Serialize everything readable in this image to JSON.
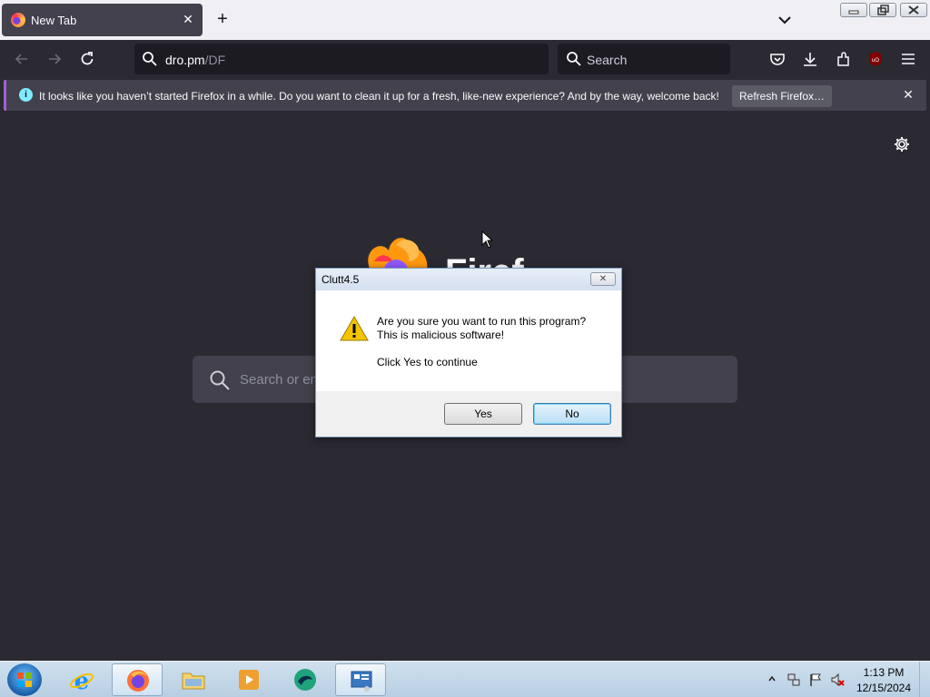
{
  "browser": {
    "tab": {
      "title": "New Tab",
      "close_glyph": "✕"
    },
    "new_tab_glyph": "+",
    "url": {
      "host": "dro.pm",
      "path": "/DF"
    },
    "search_placeholder": "Search",
    "notification": {
      "icon_glyph": "i",
      "text": "It looks like you haven’t started Firefox in a while. Do you want to clean it up for a fresh, like-new experience? And by the way, welcome back!",
      "button_label": "Refresh Firefox…",
      "close_glyph": "✕"
    },
    "content_search_placeholder": "Search or en",
    "wordmark": "Firef"
  },
  "dialog": {
    "title": "Clutt4.5",
    "close_glyph": "✕",
    "message_line1": "Are you sure you want to run this program?",
    "message_line2": "This is malicious software!",
    "message_line3": "Click Yes to continue",
    "yes_label": "Yes",
    "no_label": "No"
  },
  "taskbar": {
    "items": [
      "internet-explorer",
      "firefox",
      "file-explorer",
      "media-player",
      "app-green",
      "control-panel"
    ],
    "clock_time": "1:13 PM",
    "clock_date": "12/15/2024"
  },
  "colors": {
    "chrome_dark": "#2b2a33",
    "field_dark": "#1c1b22",
    "notification_bg": "#42414d",
    "accent_purple": "#a260d9",
    "info_cyan": "#80ebff"
  }
}
